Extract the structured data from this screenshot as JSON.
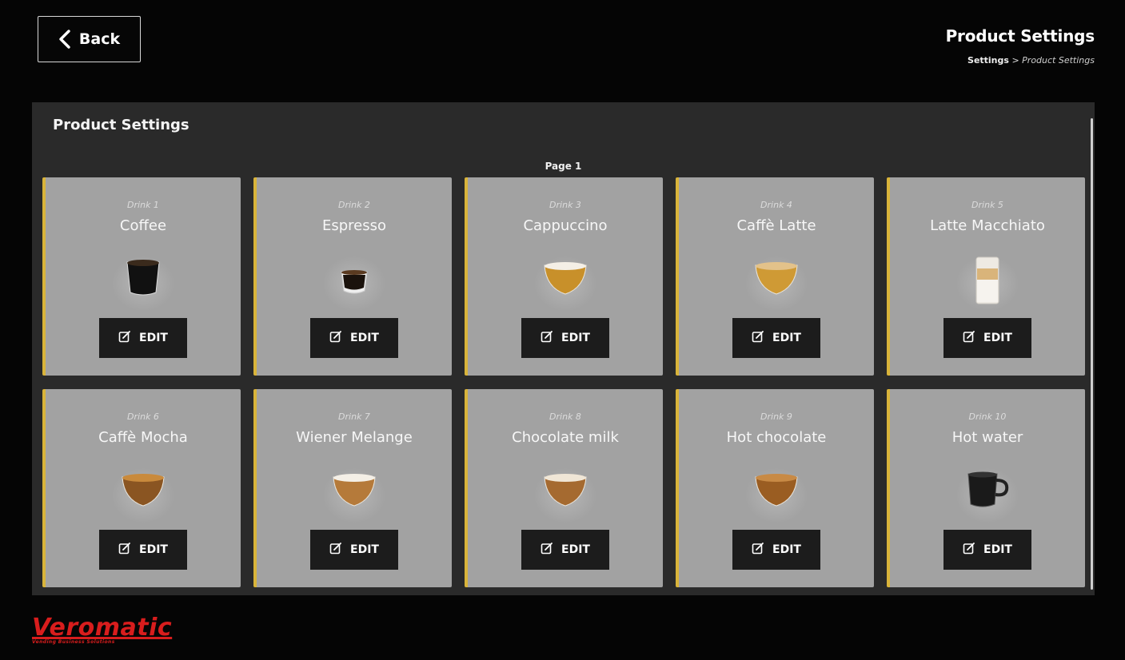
{
  "header": {
    "back_label": "Back",
    "title": "Product Settings",
    "breadcrumb_root": "Settings",
    "breadcrumb_separator": ">",
    "breadcrumb_current": "Product Settings"
  },
  "panel": {
    "title": "Product Settings",
    "page_label": "Page 1"
  },
  "edit_label": "EDIT",
  "drinks": [
    {
      "number": "Drink 1",
      "name": "Coffee",
      "icon": "black-coffee-cup-icon"
    },
    {
      "number": "Drink 2",
      "name": "Espresso",
      "icon": "espresso-cup-icon"
    },
    {
      "number": "Drink 3",
      "name": "Cappuccino",
      "icon": "cappuccino-cup-icon"
    },
    {
      "number": "Drink 4",
      "name": "Caffè Latte",
      "icon": "caffe-latte-cup-icon"
    },
    {
      "number": "Drink 5",
      "name": "Latte Macchiato",
      "icon": "latte-macchiato-glass-icon"
    },
    {
      "number": "Drink 6",
      "name": "Caffè Mocha",
      "icon": "caffe-mocha-cup-icon"
    },
    {
      "number": "Drink 7",
      "name": "Wiener Melange",
      "icon": "wiener-melange-cup-icon"
    },
    {
      "number": "Drink 8",
      "name": "Chocolate milk",
      "icon": "chocolate-milk-cup-icon"
    },
    {
      "number": "Drink 9",
      "name": "Hot chocolate",
      "icon": "hot-chocolate-cup-icon"
    },
    {
      "number": "Drink 10",
      "name": "Hot water",
      "icon": "hot-water-mug-icon"
    }
  ],
  "logo": {
    "text": "Veromatic",
    "tagline": "Vending Business Solutions"
  },
  "colors": {
    "background": "#050505",
    "panel": "#2a2a2a",
    "card": "#a2a2a2",
    "card_accent": "#d9b43a",
    "button": "#1c1c1c",
    "logo": "#d81d1d"
  }
}
